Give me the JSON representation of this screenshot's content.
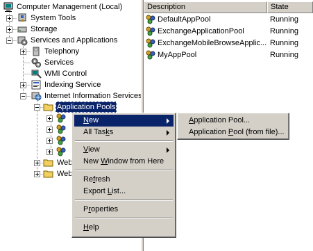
{
  "tree": {
    "root": "Computer Management (Local)",
    "system_tools": "System Tools",
    "storage": "Storage",
    "services_apps": "Services and Applications",
    "telephony": "Telephony",
    "services": "Services",
    "wmi": "WMI Control",
    "indexing": "Indexing Service",
    "iis": "Internet Information Services",
    "app_pools": "Application Pools",
    "web1": "Web",
    "web2": "Web"
  },
  "list": {
    "col_description": "Description",
    "col_state": "State",
    "rows": [
      {
        "name": "DefaultAppPool",
        "state": "Running"
      },
      {
        "name": "ExchangeApplicationPool",
        "state": "Running"
      },
      {
        "name": "ExchangeMobileBrowseApplic...",
        "state": "Running"
      },
      {
        "name": "MyAppPool",
        "state": "Running"
      }
    ]
  },
  "context_menu": {
    "new_pre": "",
    "new_u": "N",
    "new_post": "ew",
    "alltasks_pre": "All Tas",
    "alltasks_u": "k",
    "alltasks_post": "s",
    "view_pre": "",
    "view_u": "V",
    "view_post": "iew",
    "newwindow_pre": "New ",
    "newwindow_u": "W",
    "newwindow_post": "indow from Here",
    "refresh_pre": "Re",
    "refresh_u": "f",
    "refresh_post": "resh",
    "export_pre": "Export ",
    "export_u": "L",
    "export_post": "ist...",
    "properties_pre": "P",
    "properties_u": "r",
    "properties_post": "operties",
    "help_pre": "",
    "help_u": "H",
    "help_post": "elp"
  },
  "submenu": {
    "pool_pre": "",
    "pool_u": "A",
    "pool_post": "pplication Pool...",
    "poolfile_pre": "Application ",
    "poolfile_u": "P",
    "poolfile_post": "ool (from file)..."
  },
  "colors": {
    "selection": "#0a246a",
    "menu_bg": "#d4d0c8"
  }
}
